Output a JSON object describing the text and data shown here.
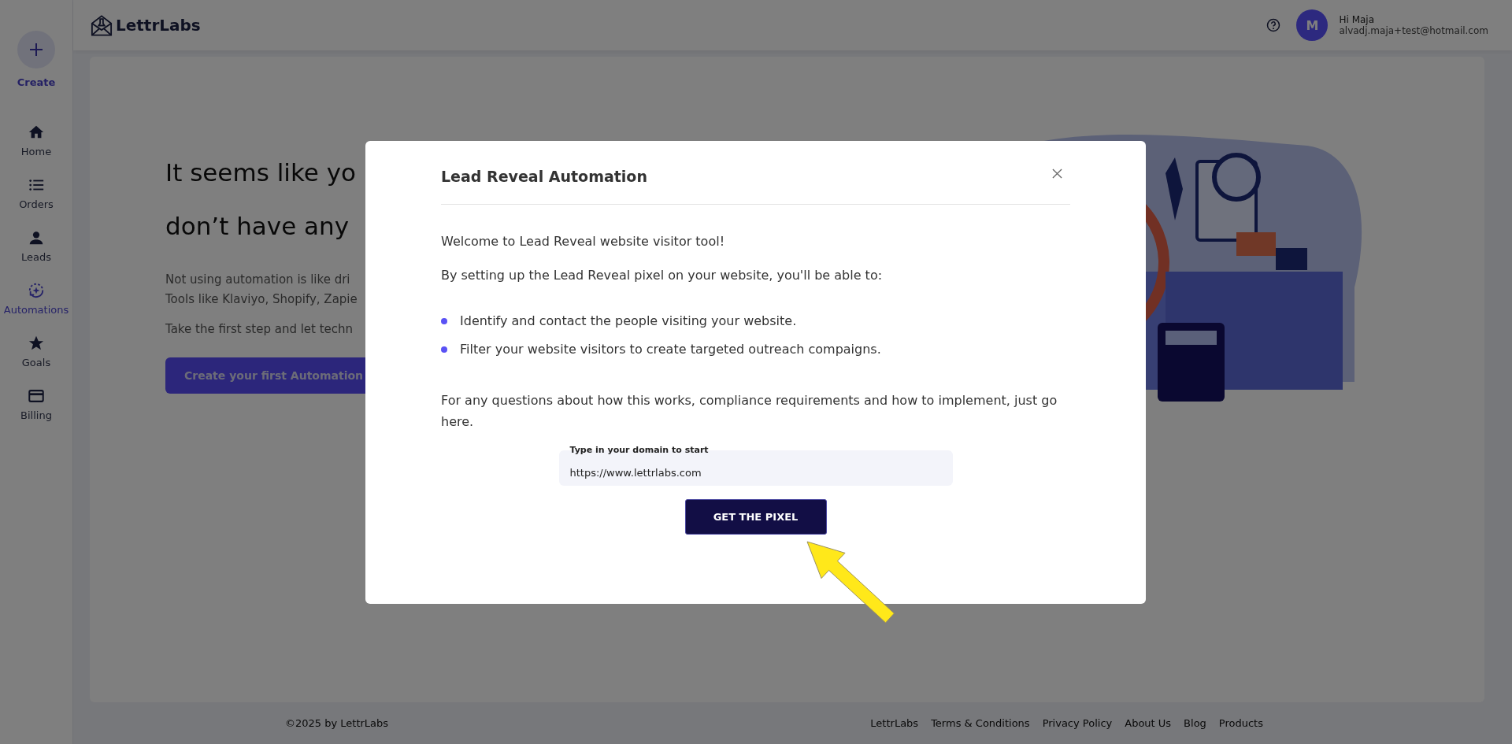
{
  "sidebar": {
    "create": {
      "label": "Create"
    },
    "items": [
      {
        "label": "Home",
        "selected": false
      },
      {
        "label": "Orders",
        "selected": false
      },
      {
        "label": "Leads",
        "selected": false
      },
      {
        "label": "Automations",
        "selected": true
      },
      {
        "label": "Goals",
        "selected": false
      },
      {
        "label": "Billing",
        "selected": false
      }
    ]
  },
  "header": {
    "logo": "LettrLabs",
    "user": {
      "initial": "M",
      "greeting": "Hi Maja",
      "email": "alvadj.maja+test@hotmail.com"
    }
  },
  "empty_state": {
    "heading_lines": [
      "It seems like yo",
      "don’t have any"
    ],
    "paragraph_lines": [
      "Not using automation is like dri",
      "Tools like Klaviyo, Shopify, Zapie"
    ],
    "paragraph_2": "Take the first step and let techn",
    "button": "Create your first Automation"
  },
  "modal": {
    "title": "Lead Reveal Automation",
    "intro": "Welcome to Lead Reveal website visitor tool!",
    "lead": "By setting up the Lead Reveal pixel on your website, you'll be able to:",
    "bullets": [
      "Identify and contact the people visiting your website.",
      "Filter your website visitors to create targeted outreach compaigns."
    ],
    "note": "For any questions about how this works, compliance requirements and how to implement, just go here.",
    "field": {
      "label": "Type in your domain to start",
      "value": "https://www.lettrlabs.com"
    },
    "button": "GET THE PIXEL"
  },
  "footer": {
    "copyright": "©2025 by LettrLabs",
    "links": [
      "LettrLabs",
      "Terms & Conditions",
      "Privacy Policy",
      "About Us",
      "Blog",
      "Products"
    ]
  }
}
